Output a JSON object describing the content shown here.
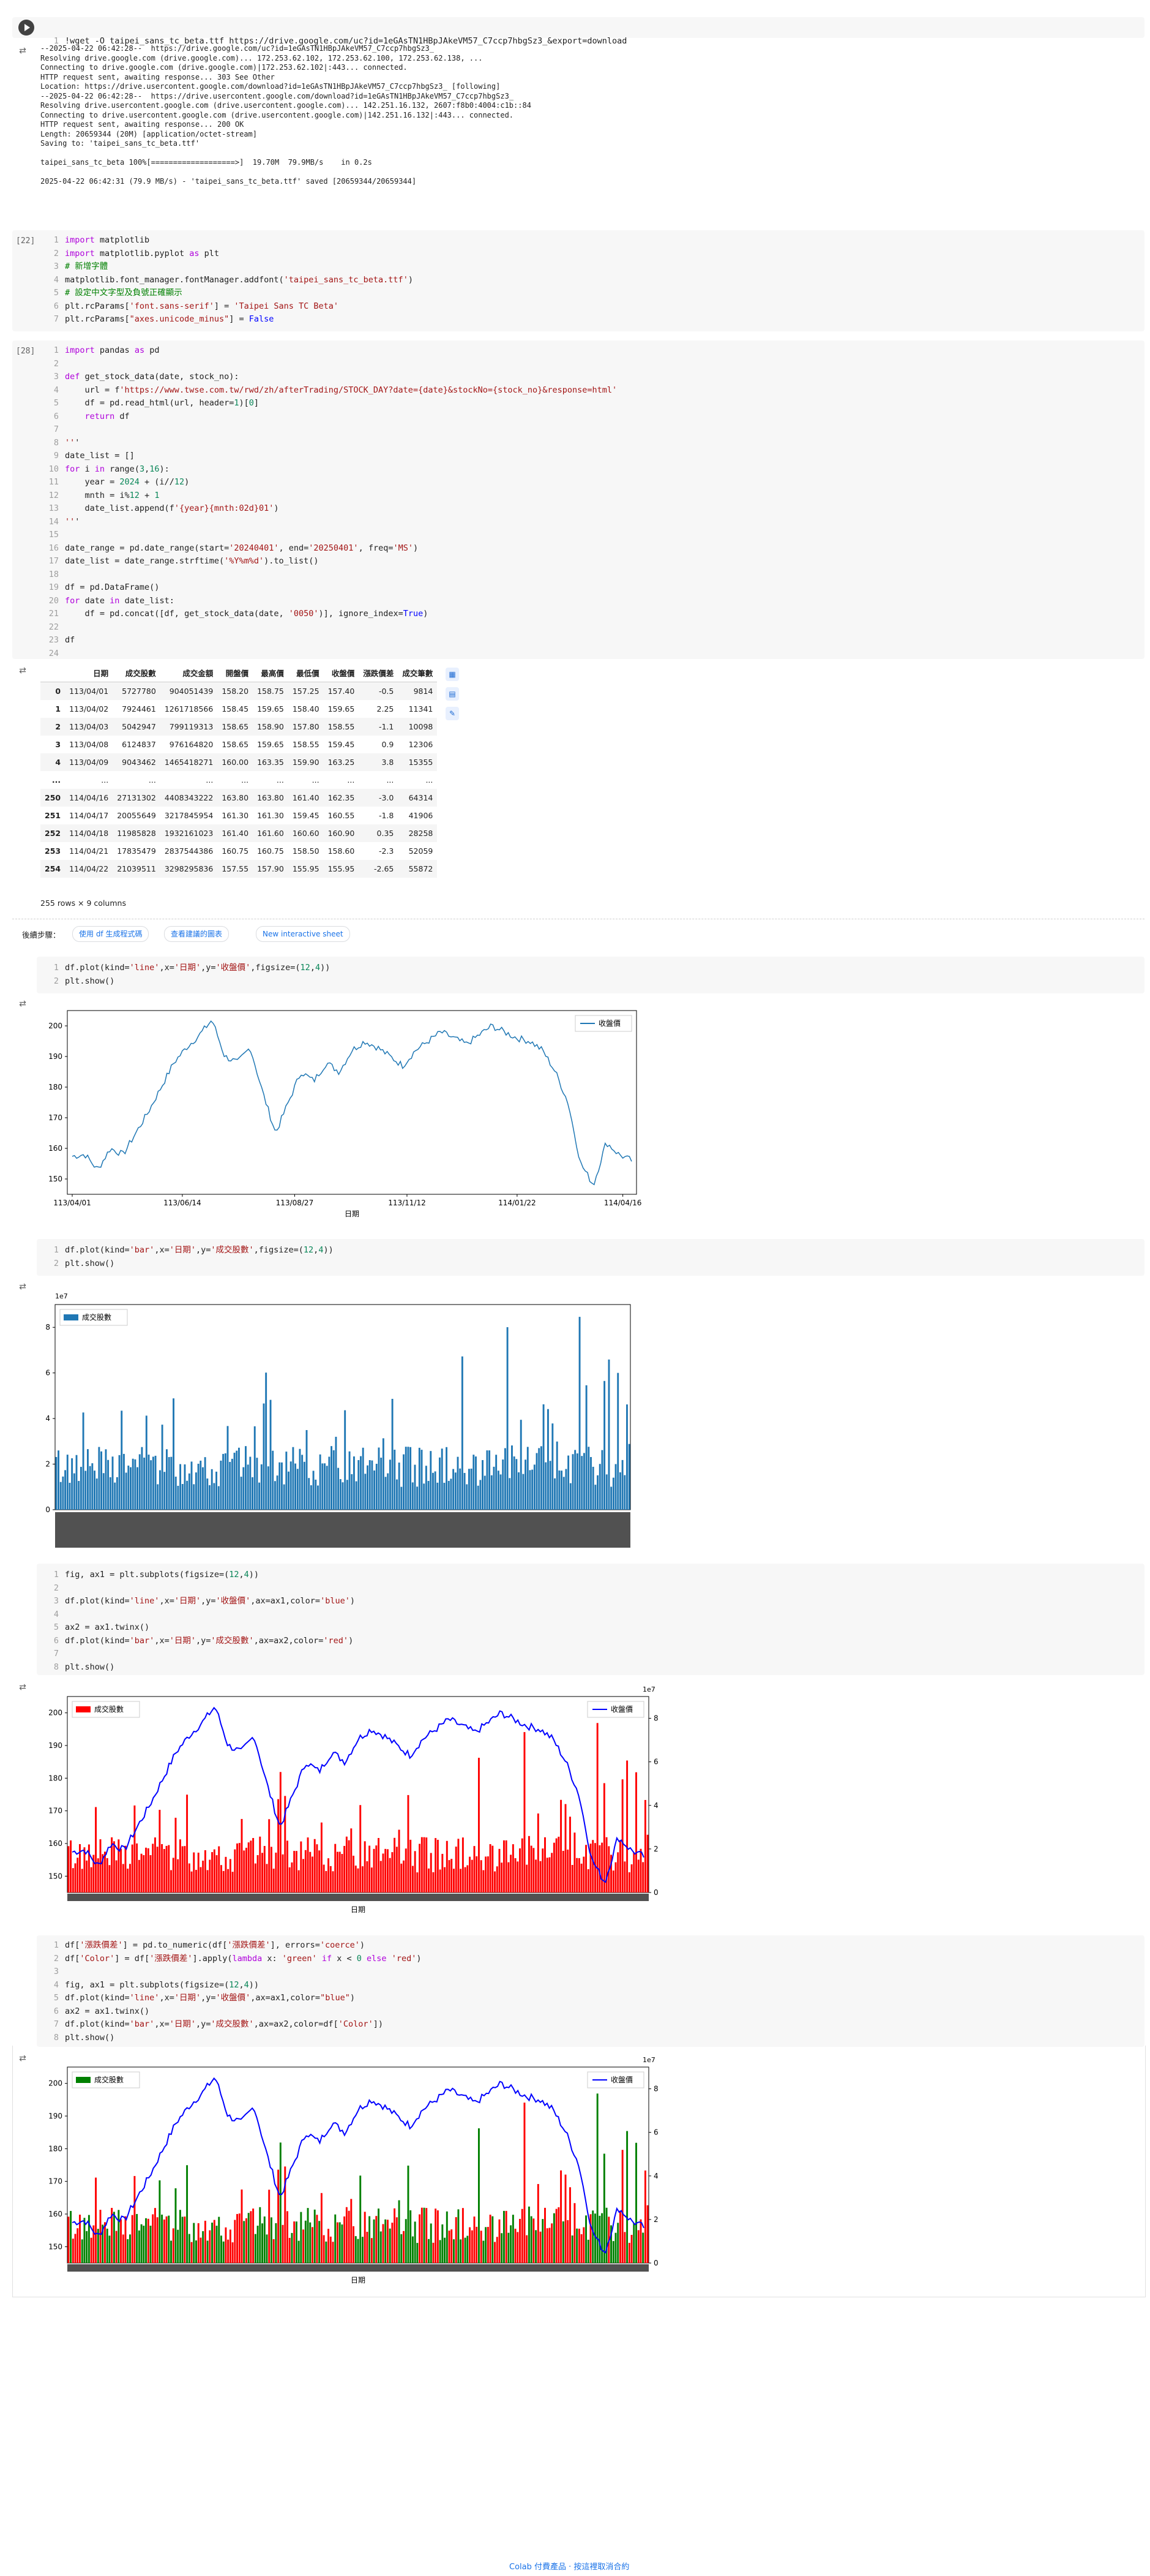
{
  "cells": {
    "c1": {
      "exec_label": "",
      "code": "!wget -O taipei_sans_tc_beta.ttf https://drive.google.com/uc?id=1eGAsTN1HBpJAkeVM57_C7ccp7hbgSz3_&export=download",
      "output_lines": [
        "--2025-04-22 06:42:28--  https://drive.google.com/uc?id=1eGAsTN1HBpJAkeVM57_C7ccp7hbgSz3_",
        "Resolving drive.google.com (drive.google.com)... 172.253.62.102, 172.253.62.100, 172.253.62.138, ...",
        "Connecting to drive.google.com (drive.google.com)|172.253.62.102|:443... connected.",
        "HTTP request sent, awaiting response... 303 See Other",
        "Location: https://drive.usercontent.google.com/download?id=1eGAsTN1HBpJAkeVM57_C7ccp7hbgSz3_ [following]",
        "--2025-04-22 06:42:28--  https://drive.usercontent.google.com/download?id=1eGAsTN1HBpJAkeVM57_C7ccp7hbgSz3_",
        "Resolving drive.usercontent.google.com (drive.usercontent.google.com)... 142.251.16.132, 2607:f8b0:4004:c1b::84",
        "Connecting to drive.usercontent.google.com (drive.usercontent.google.com)|142.251.16.132|:443... connected.",
        "HTTP request sent, awaiting response... 200 OK",
        "Length: 20659344 (20M) [application/octet-stream]",
        "Saving to: 'taipei_sans_tc_beta.ttf'",
        "",
        "taipei_sans_tc_beta 100%[===================>]  19.70M  79.9MB/s    in 0.2s",
        "",
        "2025-04-22 06:42:31 (79.9 MB/s) - 'taipei_sans_tc_beta.ttf' saved [20659344/20659344]"
      ]
    },
    "c2": {
      "exec_label": "[22]",
      "lines": [
        "import matplotlib",
        "import matplotlib.pyplot as plt",
        "# 新增字體",
        "matplotlib.font_manager.fontManager.addfont('taipei_sans_tc_beta.ttf')",
        "# 設定中文字型及負號正確顯示",
        "plt.rcParams['font.sans-serif'] = 'Taipei Sans TC Beta'",
        "plt.rcParams[\"axes.unicode_minus\"] = False"
      ]
    },
    "c3": {
      "exec_label": "[28]",
      "lines": [
        "import pandas as pd",
        "",
        "def get_stock_data(date, stock_no):",
        "    url = f'https://www.twse.com.tw/rwd/zh/afterTrading/STOCK_DAY?date={date}&stockNo={stock_no}&response=html'",
        "    df = pd.read_html(url, header=1)[0]",
        "    return df",
        "",
        "'''",
        "date_list = []",
        "for i in range(3,16):",
        "    year = 2024 + (i//12)",
        "    mnth = i%12 + 1",
        "    date_list.append(f'{year}{mnth:02d}01')",
        "'''",
        "",
        "date_range = pd.date_range(start='20240401', end='20250401', freq='MS')",
        "date_list = date_range.strftime('%Y%m%d').to_list()",
        "",
        "df = pd.DataFrame()",
        "for date in date_list:",
        "    df = pd.concat([df, get_stock_data(date, '0050')], ignore_index=True)",
        "",
        "df",
        ""
      ]
    },
    "df_table": {
      "headers": [
        "",
        "日期",
        "成交股數",
        "成交金額",
        "開盤價",
        "最高價",
        "最低價",
        "收盤價",
        "漲跌價差",
        "成交筆數"
      ],
      "rows": [
        [
          "0",
          "113/04/01",
          "5727780",
          "904051439",
          "158.20",
          "158.75",
          "157.25",
          "157.40",
          "-0.5",
          "9814"
        ],
        [
          "1",
          "113/04/02",
          "7924461",
          "1261718566",
          "158.45",
          "159.65",
          "158.40",
          "159.65",
          "2.25",
          "11341"
        ],
        [
          "2",
          "113/04/03",
          "5042947",
          "799119313",
          "158.65",
          "158.90",
          "157.80",
          "158.55",
          "-1.1",
          "10098"
        ],
        [
          "3",
          "113/04/08",
          "6124837",
          "976164820",
          "158.65",
          "159.65",
          "158.55",
          "159.45",
          "0.9",
          "12306"
        ],
        [
          "4",
          "113/04/09",
          "9043462",
          "1465418271",
          "160.00",
          "163.35",
          "159.90",
          "163.25",
          "3.8",
          "15355"
        ],
        [
          "...",
          "...",
          "...",
          "...",
          "...",
          "...",
          "...",
          "...",
          "...",
          "..."
        ],
        [
          "250",
          "114/04/16",
          "27131302",
          "4408343222",
          "163.80",
          "163.80",
          "161.40",
          "162.35",
          "-3.0",
          "64314"
        ],
        [
          "251",
          "114/04/17",
          "20055649",
          "3217845954",
          "161.30",
          "161.30",
          "159.45",
          "160.55",
          "-1.8",
          "41906"
        ],
        [
          "252",
          "114/04/18",
          "11985828",
          "1932161023",
          "161.40",
          "161.60",
          "160.60",
          "160.90",
          "0.35",
          "28258"
        ],
        [
          "253",
          "114/04/21",
          "17835479",
          "2837544386",
          "160.75",
          "160.75",
          "158.50",
          "158.60",
          "-2.3",
          "52059"
        ],
        [
          "254",
          "114/04/22",
          "21039511",
          "3298295836",
          "157.55",
          "157.90",
          "155.95",
          "155.95",
          "-2.65",
          "55872"
        ]
      ],
      "shape_text": "255 rows × 9 columns"
    },
    "next_steps": {
      "label": "後續步驟：",
      "chips": [
        "使用 df 生成程式碼",
        "查看建議的圖表",
        "New interactive sheet"
      ]
    },
    "c4": {
      "lines": [
        "df.plot(kind='line',x='日期',y='收盤價',figsize=(12,4))",
        "plt.show()"
      ]
    },
    "c5": {
      "lines": [
        "df.plot(kind='bar',x='日期',y='成交股數',figsize=(12,4))",
        "plt.show()"
      ]
    },
    "c6": {
      "lines": [
        "fig, ax1 = plt.subplots(figsize=(12,4))",
        "",
        "df.plot(kind='line',x='日期',y='收盤價',ax=ax1,color='blue')",
        "",
        "ax2 = ax1.twinx()",
        "df.plot(kind='bar',x='日期',y='成交股數',ax=ax2,color='red')",
        "",
        "plt.show()"
      ]
    },
    "c7": {
      "lines": [
        "df['漲跌價差'] = pd.to_numeric(df['漲跌價差'], errors='coerce')",
        "df['Color'] = df['漲跌價差'].apply(lambda x: 'green' if x < 0 else 'red')",
        "",
        "fig, ax1 = plt.subplots(figsize=(12,4))",
        "df.plot(kind='line',x='日期',y='收盤價',ax=ax1,color=\"blue\")",
        "ax2 = ax1.twinx()",
        "df.plot(kind='bar',x='日期',y='成交股數',ax=ax2,color=df['Color'])",
        "plt.show()"
      ]
    }
  },
  "chart_data": [
    {
      "type": "line",
      "title": "",
      "xlabel": "日期",
      "ylabel": "",
      "x_ticks": [
        "113/04/01",
        "113/06/14",
        "113/08/27",
        "113/11/12",
        "114/01/22",
        "114/04/16"
      ],
      "y_ticks": [
        150,
        160,
        170,
        180,
        190,
        200
      ],
      "ylim": [
        145,
        205
      ],
      "legend": "top-right",
      "series": [
        {
          "name": "收盤價",
          "color": "#1f77b4",
          "key_values": [
            157.4,
            158,
            153,
            160,
            158,
            165,
            172,
            180,
            188,
            193,
            197,
            202,
            190,
            188,
            193,
            178,
            165,
            175,
            185,
            182,
            188,
            185,
            192,
            195,
            193,
            190,
            187,
            192,
            195,
            198,
            196,
            194,
            197,
            200,
            198,
            196,
            195,
            192,
            185,
            175,
            155,
            148,
            162,
            158,
            156
          ]
        }
      ]
    },
    {
      "type": "bar",
      "title": "",
      "xlabel": "日期",
      "ylabel": "",
      "y_scale_label": "1e7",
      "y_ticks": [
        0,
        2,
        4,
        6,
        8
      ],
      "ylim": [
        0,
        9
      ],
      "legend": "top-left",
      "series": [
        {
          "name": "成交股數",
          "color": "#1f77b4"
        }
      ]
    },
    {
      "type": "line",
      "title": "",
      "xlabel": "日期",
      "y_ticks_left": [
        150,
        160,
        170,
        180,
        190,
        200
      ],
      "y_ticks_right": [
        0,
        2,
        4,
        6,
        8
      ],
      "y_scale_label": "1e7",
      "series": [
        {
          "name": "收盤價",
          "color": "#0000ff"
        },
        {
          "name": "成交股數",
          "color": "#ff0000"
        }
      ]
    },
    {
      "type": "line",
      "title": "",
      "xlabel": "日期",
      "y_ticks_left": [
        150,
        160,
        170,
        180,
        190,
        200
      ],
      "y_ticks_right": [
        0,
        2,
        4,
        6,
        8
      ],
      "y_scale_label": "1e7",
      "series": [
        {
          "name": "收盤價",
          "color": "#0000ff"
        },
        {
          "name": "成交股數",
          "color": "#008000"
        }
      ]
    }
  ],
  "footer": {
    "text": "Colab 付費產品 · 按這裡取消合約"
  }
}
